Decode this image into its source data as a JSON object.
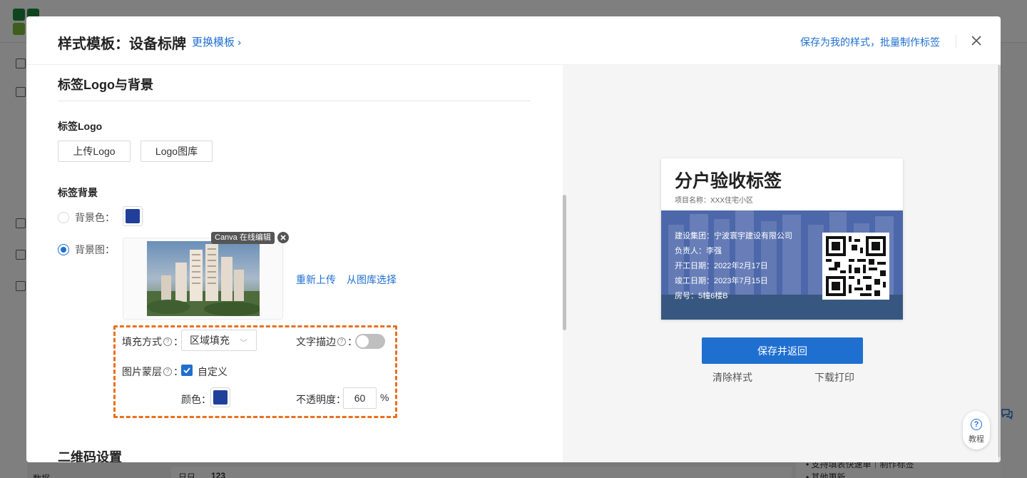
{
  "modal": {
    "title": "样式模板：设备标牌",
    "change_template": "更换模板 ›",
    "save_my_style": "保存为我的样式，批量制作标签"
  },
  "left": {
    "section_title": "标签Logo与背景",
    "logo_label": "标签Logo",
    "upload_logo": "上传Logo",
    "logo_library": "Logo图库",
    "bg_label": "标签背景",
    "bg_color_option": "背景色：",
    "bg_color": "#1f3f9a",
    "bg_image_option": "背景图：",
    "canva_tag": "Canva 在线编辑",
    "reupload": "重新上传",
    "from_library": "从图库选择",
    "fill_mode_label": "填充方式",
    "fill_mode_value": "区域填充",
    "text_stroke_label": "文字描边",
    "text_stroke_on": false,
    "image_mask_label": "图片蒙层",
    "custom_label": "自定义",
    "custom_checked": true,
    "color_label": "颜色：",
    "mask_color": "#1f3f9a",
    "opacity_label": "不透明度：",
    "opacity_value": "60",
    "opacity_unit": "%",
    "qr_section_title": "二维码设置"
  },
  "preview": {
    "label_title": "分户验收标签",
    "project_name": "项目名称：XXX住宅小区",
    "info": [
      "建设集团：宁波寰宇建设有限公司",
      "负责人：李强",
      "开工日期：2022年2月17日",
      "竣工日期：2023年7月15日",
      "房号：5幢6楼B"
    ],
    "save_return": "保存并返回",
    "clear_style": "清除样式",
    "download_print": "下载打印",
    "help_label": "教程"
  },
  "background": {
    "bottom_left": "数据",
    "bottom_mid_a": "日日",
    "bottom_mid_b": "123",
    "bottom_right_a": "• 支持填表快速单｜制作标签",
    "bottom_right_b": "• 其他更新"
  },
  "colors": {
    "accent": "#1f6fd1",
    "highlight_dash": "#e8701f",
    "label_overlay": "#1f3f9a"
  }
}
